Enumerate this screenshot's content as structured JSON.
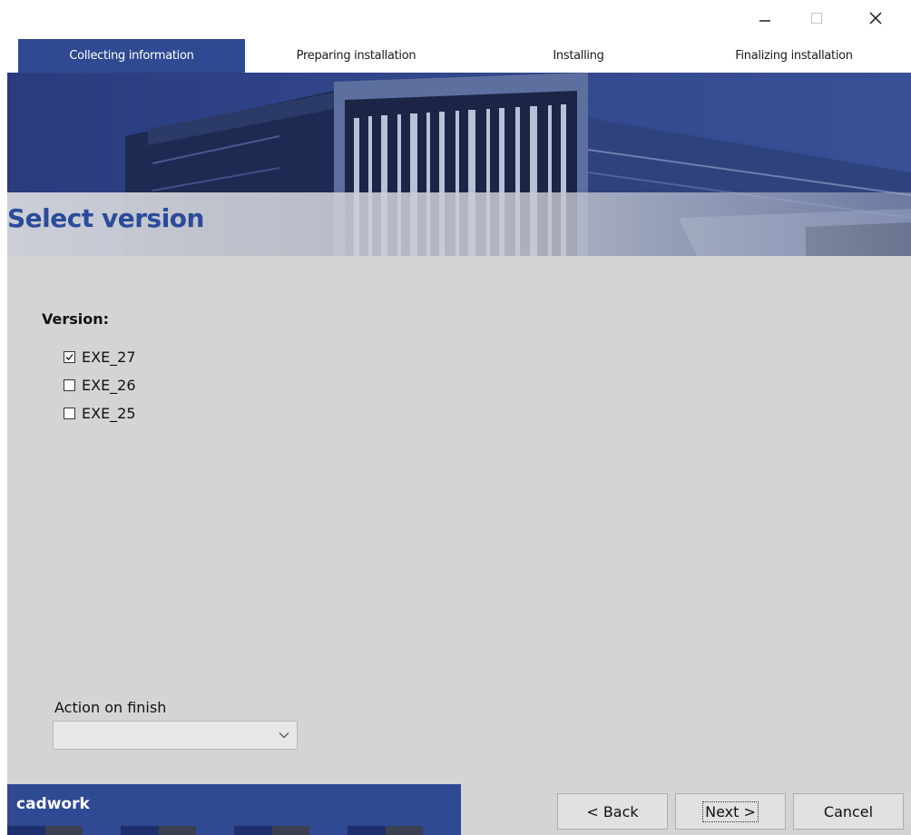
{
  "window": {
    "controls": {
      "minimize_icon": "minimize-icon",
      "maximize_icon": "maximize-icon",
      "close_icon": "close-icon"
    }
  },
  "tabs": [
    {
      "label": "Collecting information",
      "active": true
    },
    {
      "label": "Preparing installation",
      "active": false
    },
    {
      "label": "Installing",
      "active": false
    },
    {
      "label": "Finalizing installation",
      "active": false
    }
  ],
  "header": {
    "title": "Select version"
  },
  "version_section": {
    "label": "Version:",
    "options": [
      {
        "label": "EXE_27",
        "checked": true
      },
      {
        "label": "EXE_26",
        "checked": false
      },
      {
        "label": "EXE_25",
        "checked": false
      }
    ]
  },
  "action_on_finish": {
    "label": "Action on finish",
    "selected_value": ""
  },
  "footer": {
    "brand": "cadwork",
    "buttons": {
      "back": "< Back",
      "next": "Next >",
      "cancel": "Cancel"
    }
  },
  "colors": {
    "accent": "#2f4a92",
    "title_text": "#2b4b9a",
    "content_bg": "#d4d4d4"
  }
}
